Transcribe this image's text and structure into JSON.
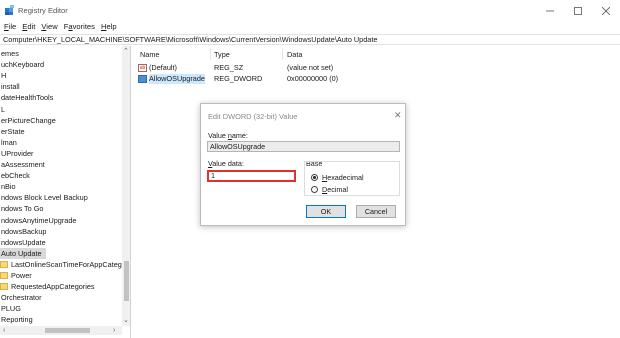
{
  "window": {
    "title": "Registry Editor",
    "menu": [
      {
        "mnemonic": "F",
        "rest": "ile"
      },
      {
        "mnemonic": "E",
        "rest": "dit"
      },
      {
        "mnemonic": "V",
        "rest": "iew"
      },
      {
        "pre": "F",
        "mnemonic": "a",
        "rest": "vorites"
      },
      {
        "mnemonic": "H",
        "rest": "elp"
      }
    ],
    "address": "Computer\\HKEY_LOCAL_MACHINE\\SOFTWARE\\Microsoft\\Windows\\CurrentVersion\\WindowsUpdate\\Auto Update"
  },
  "tree": {
    "items": [
      {
        "label": "emes",
        "indent": 0,
        "folder": false
      },
      {
        "label": "uchKeyboard",
        "indent": 0,
        "folder": false
      },
      {
        "label": "H",
        "indent": 0,
        "folder": false
      },
      {
        "label": "install",
        "indent": 0,
        "folder": false
      },
      {
        "label": "dateHealthTools",
        "indent": 0,
        "folder": false
      },
      {
        "label": "L",
        "indent": 0,
        "folder": false
      },
      {
        "label": "erPictureChange",
        "indent": 0,
        "folder": false
      },
      {
        "label": "erState",
        "indent": 0,
        "folder": false
      },
      {
        "label": "lman",
        "indent": 0,
        "folder": false
      },
      {
        "label": "UProvider",
        "indent": 0,
        "folder": false
      },
      {
        "label": "aAssessment",
        "indent": 0,
        "folder": false
      },
      {
        "label": "ebCheck",
        "indent": 0,
        "folder": false
      },
      {
        "label": "nBio",
        "indent": 0,
        "folder": false
      },
      {
        "label": "ndows Block Level Backup",
        "indent": 0,
        "folder": false
      },
      {
        "label": "ndows To Go",
        "indent": 0,
        "folder": false
      },
      {
        "label": "ndowsAnytimeUpgrade",
        "indent": 0,
        "folder": false
      },
      {
        "label": "ndowsBackup",
        "indent": 0,
        "folder": false
      },
      {
        "label": "ndowsUpdate",
        "indent": 0,
        "folder": false
      },
      {
        "label": "Auto Update",
        "indent": 0,
        "folder": false,
        "selected": true
      },
      {
        "label": "LastOnlineScanTimeForAppCateg",
        "indent": 1,
        "folder": true
      },
      {
        "label": "Power",
        "indent": 1,
        "folder": true
      },
      {
        "label": "RequestedAppCategories",
        "indent": 1,
        "folder": true
      },
      {
        "label": "Orchestrator",
        "indent": 0,
        "folder": false
      },
      {
        "label": "PLUG",
        "indent": 0,
        "folder": false
      },
      {
        "label": "Reporting",
        "indent": 0,
        "folder": false
      }
    ]
  },
  "list": {
    "headers": {
      "name": "Name",
      "type": "Type",
      "data": "Data"
    },
    "rows": [
      {
        "name": "(Default)",
        "type": "REG_SZ",
        "data": "(value not set)",
        "icon": "string-value-icon"
      },
      {
        "name": "AllowOSUpgrade",
        "type": "REG_DWORD",
        "data": "0x00000000 (0)",
        "icon": "dword-value-icon",
        "selected": true
      }
    ]
  },
  "dialog": {
    "title": "Edit DWORD (32-bit) Value",
    "close_glyph": "✕",
    "name_label_mn": "n",
    "name_label_pre": "Value ",
    "name_label_post": "ame:",
    "name_value": "AllowOSUpgrade",
    "data_label_mn": "V",
    "data_label_rest": "alue data:",
    "data_value": "1",
    "base_label": "Base",
    "hex_mn": "H",
    "hex_rest": "exadecimal",
    "dec_mn": "D",
    "dec_rest": "ecimal",
    "base_selected": "Hexadecimal",
    "ok_label": "OK",
    "cancel_label": "Cancel"
  },
  "colors": {
    "accent": "#0078d7",
    "highlight_border": "#e03030",
    "selection": "#cce8ff"
  }
}
